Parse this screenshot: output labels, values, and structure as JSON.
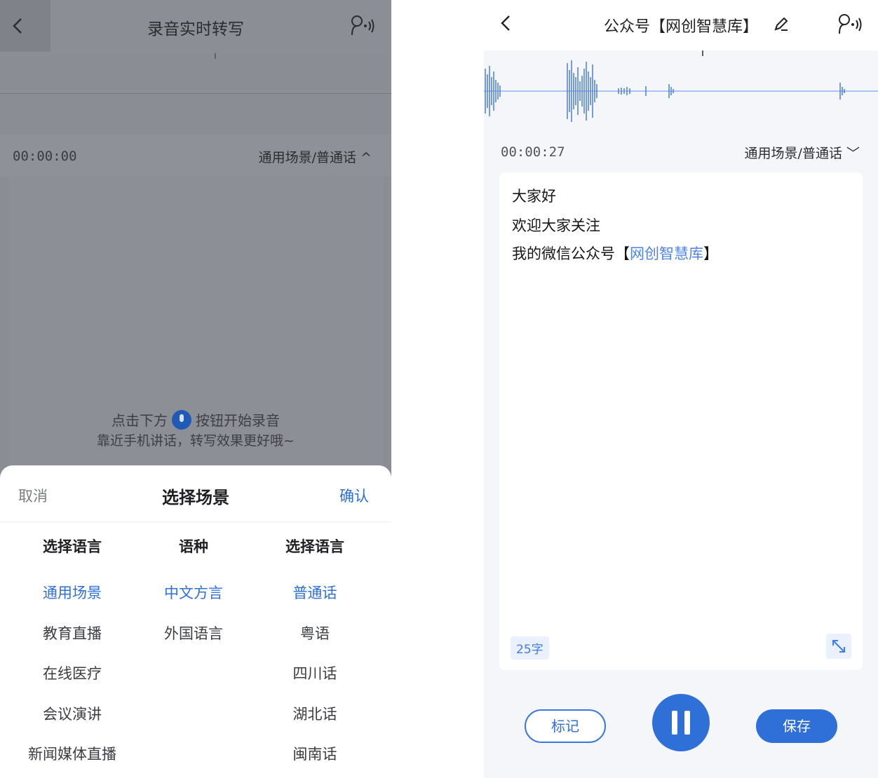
{
  "left": {
    "title": "录音实时转写",
    "timer": "00:00:00",
    "scene": "通用场景/普通话 ^",
    "hint_before": "点击下方",
    "hint_after": "按钮开始录音",
    "hint2": "靠近手机讲话，转写效果更好哦~",
    "sheet": {
      "cancel": "取消",
      "title": "选择场景",
      "confirm": "确认",
      "columns": [
        {
          "header": "选择语言",
          "options": [
            "通用场景",
            "教育直播",
            "在线医疗",
            "会议演讲",
            "新闻媒体直播"
          ]
        },
        {
          "header": "语种",
          "options": [
            "中文方言",
            "外国语言"
          ]
        },
        {
          "header": "选择语言",
          "options": [
            "普通话",
            "粤语",
            "四川话",
            "湖北话",
            "闽南话"
          ]
        }
      ]
    }
  },
  "right": {
    "title": "公众号【网创智慧库】",
    "timer": "00:00:27",
    "scene": "通用场景/普通话 ﹀",
    "lines": [
      "大家好",
      "欢迎大家关注",
      "我的微信公众号【",
      "网创智慧库",
      "】"
    ],
    "count": "25字",
    "mark": "标记",
    "save": "保存"
  },
  "colors": {
    "accent": "#2f6fd8",
    "overlay": "#8a8d93",
    "highlight": "#4f86e6"
  },
  "icons": [
    "back-arrow-icon",
    "voice-speaker-icon",
    "edit-pencil-icon",
    "mic-icon",
    "expand-icon",
    "pause-icon"
  ]
}
